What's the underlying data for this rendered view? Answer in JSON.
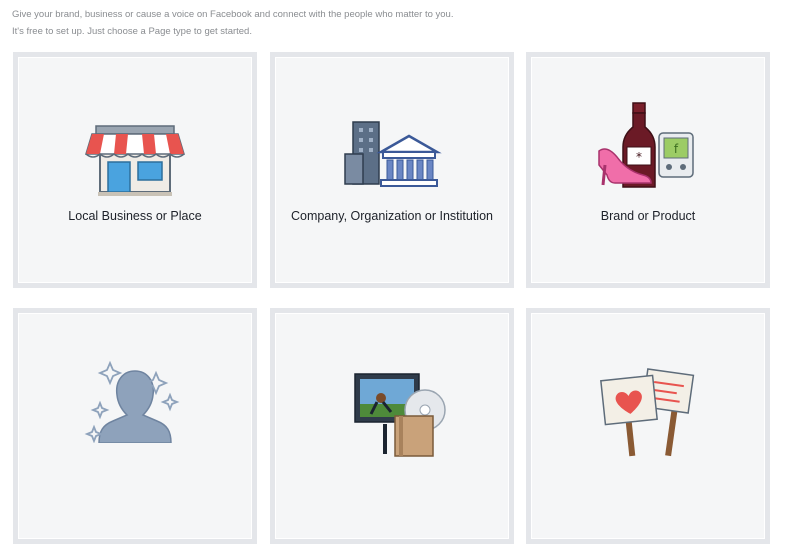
{
  "intro": {
    "line1": "Give your brand, business or cause a voice on Facebook and connect with the people who matter to you.",
    "line2": "It's free to set up. Just choose a Page type to get started."
  },
  "page_types": [
    {
      "label": "Local Business or Place",
      "icon": "storefront-icon"
    },
    {
      "label": "Company, Organization or Institution",
      "icon": "buildings-icon"
    },
    {
      "label": "Brand or Product",
      "icon": "products-icon"
    },
    {
      "label": "",
      "icon": "public-figure-icon"
    },
    {
      "label": "",
      "icon": "entertainment-icon"
    },
    {
      "label": "",
      "icon": "cause-signs-icon"
    }
  ],
  "colors": {
    "tile_bg": "#f5f6f7",
    "tile_border": "#e4e6ea",
    "awning_red": "#e8544f",
    "building_blue": "#3b5998"
  }
}
